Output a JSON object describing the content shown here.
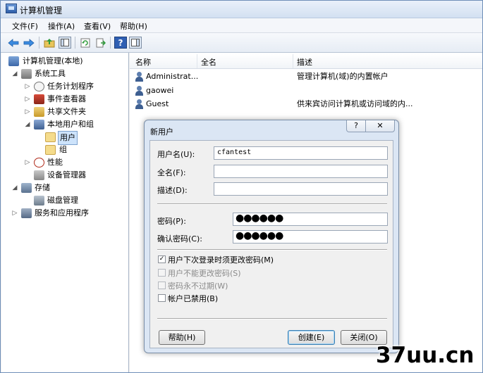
{
  "window": {
    "title": "计算机管理"
  },
  "menu": [
    "文件(F)",
    "操作(A)",
    "查看(V)",
    "帮助(H)"
  ],
  "toolbar_icons": [
    "back-arrow-icon",
    "forward-arrow-icon",
    "up-folder-icon",
    "show-hide-tree-icon",
    "refresh-icon",
    "export-list-icon",
    "help-icon",
    "action-pane-icon"
  ],
  "tree": [
    {
      "label": "计算机管理(本地)",
      "indent": 0,
      "icon": "computer-management-icon"
    },
    {
      "label": "系统工具",
      "indent": 1,
      "icon": "system-tools-icon",
      "expanded": true
    },
    {
      "label": "任务计划程序",
      "indent": 2,
      "icon": "task-scheduler-icon"
    },
    {
      "label": "事件查看器",
      "indent": 2,
      "icon": "event-viewer-icon"
    },
    {
      "label": "共享文件夹",
      "indent": 2,
      "icon": "shared-folders-icon"
    },
    {
      "label": "本地用户和组",
      "indent": 2,
      "icon": "local-users-groups-icon",
      "expanded": true
    },
    {
      "label": "用户",
      "indent": 3,
      "icon": "folder-icon",
      "selected": true
    },
    {
      "label": "组",
      "indent": 3,
      "icon": "folder-icon"
    },
    {
      "label": "性能",
      "indent": 2,
      "icon": "performance-icon"
    },
    {
      "label": "设备管理器",
      "indent": 2,
      "icon": "device-manager-icon"
    },
    {
      "label": "存储",
      "indent": 1,
      "icon": "storage-icon",
      "expanded": true
    },
    {
      "label": "磁盘管理",
      "indent": 2,
      "icon": "disk-management-icon"
    },
    {
      "label": "服务和应用程序",
      "indent": 1,
      "icon": "services-apps-icon"
    }
  ],
  "list": {
    "columns": [
      "名称",
      "全名",
      "描述"
    ],
    "rows": [
      {
        "name": "Administrat...",
        "fullname": "",
        "description": "管理计算机(域)的内置帐户"
      },
      {
        "name": "gaowei",
        "fullname": "",
        "description": ""
      },
      {
        "name": "Guest",
        "fullname": "",
        "description": "供来宾访问计算机或访问域的内..."
      }
    ]
  },
  "dialog": {
    "title": "新用户",
    "help_label": "?",
    "close_label": "✕",
    "fields": {
      "username_label": "用户名(U):",
      "username_value": "cfantest",
      "fullname_label": "全名(F):",
      "fullname_value": "",
      "description_label": "描述(D):",
      "description_value": "",
      "password_label": "密码(P):",
      "password_value": "●●●●●●",
      "confirm_label": "确认密码(C):",
      "confirm_value": "●●●●●●"
    },
    "checkboxes": [
      {
        "label": "用户下次登录时须更改密码(M)",
        "checked": true,
        "enabled": true
      },
      {
        "label": "用户不能更改密码(S)",
        "checked": false,
        "enabled": false
      },
      {
        "label": "密码永不过期(W)",
        "checked": false,
        "enabled": false
      },
      {
        "label": "帐户已禁用(B)",
        "checked": false,
        "enabled": true
      }
    ],
    "buttons": {
      "help": "帮助(H)",
      "create": "创建(E)",
      "close": "关闭(O)"
    }
  },
  "watermark": "37uu.cn"
}
